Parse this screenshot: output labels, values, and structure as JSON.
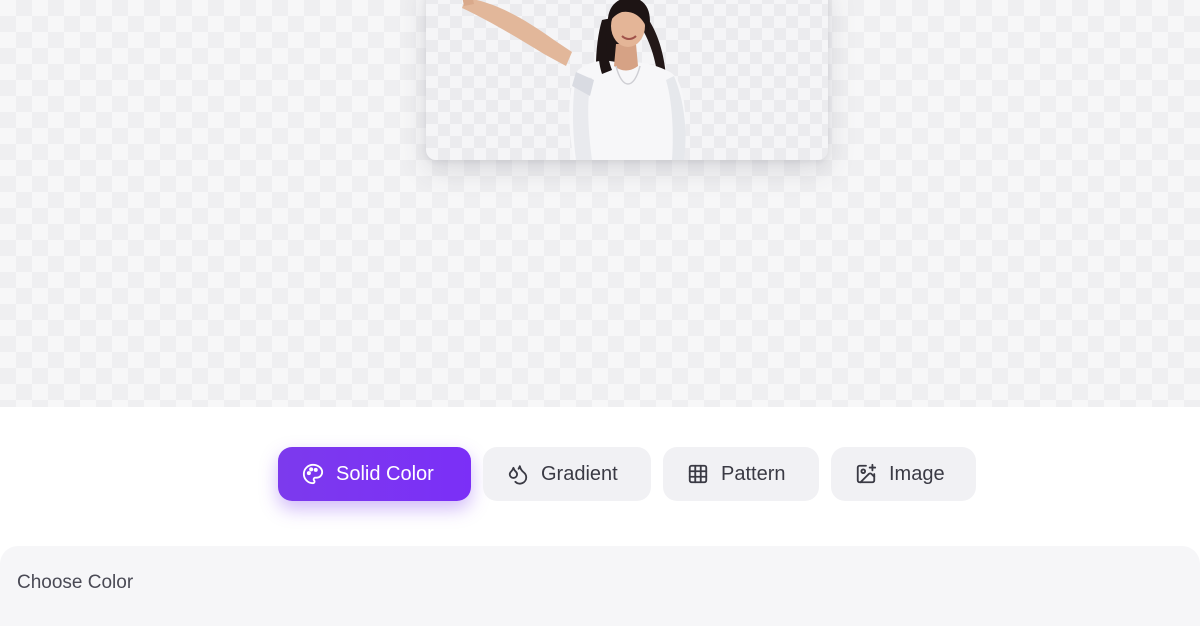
{
  "preview": {
    "image_alt": "woman with raised arm, background removed"
  },
  "tabs": [
    {
      "label": "Solid Color",
      "icon": "palette-icon",
      "active": true
    },
    {
      "label": "Gradient",
      "icon": "droplets-icon",
      "active": false
    },
    {
      "label": "Pattern",
      "icon": "grid-icon",
      "active": false
    },
    {
      "label": "Image",
      "icon": "image-plus-icon",
      "active": false
    }
  ],
  "panel": {
    "title": "Choose Color"
  },
  "colors": {
    "accent": "#7c3aed",
    "tab_bg": "#f1f1f4",
    "text": "#3a3a44"
  }
}
